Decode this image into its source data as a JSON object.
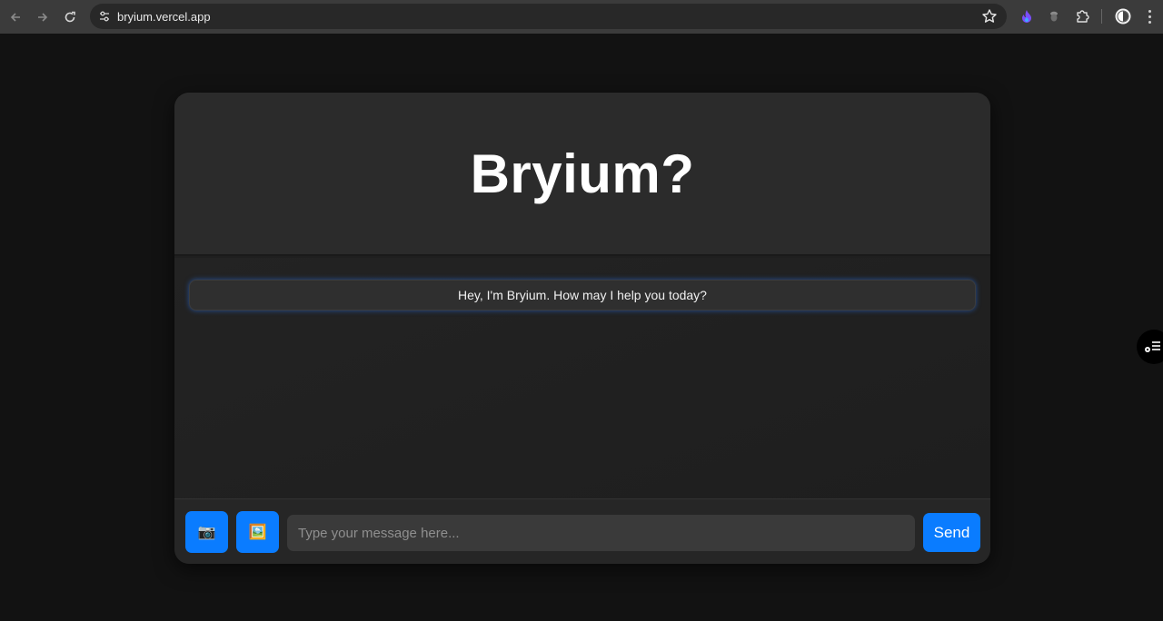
{
  "browser": {
    "url": "bryium.vercel.app",
    "icons": {
      "back": "arrow-left-icon",
      "forward": "arrow-right-icon",
      "reload": "reload-icon",
      "site_info": "tune-icon",
      "bookmark": "star-icon",
      "extensions": [
        "flame-extension-icon",
        "acorn-extension-icon",
        "puzzle-icon"
      ],
      "profile": "profile-avatar-icon",
      "menu": "more-vertical-icon"
    }
  },
  "app": {
    "title": "Bryium?",
    "greeting": "Hey, I'm Bryium. How may I help you today?",
    "input_placeholder": "Type your message here...",
    "send_label": "Send",
    "camera_icon": "📷",
    "image_icon": "🖼️"
  },
  "colors": {
    "page_bg": "#121212",
    "card_bg": "#1f1f1f",
    "header_bg": "#2b2b2b",
    "accent": "#0a7cff",
    "input_bg": "#3a3a3a"
  }
}
